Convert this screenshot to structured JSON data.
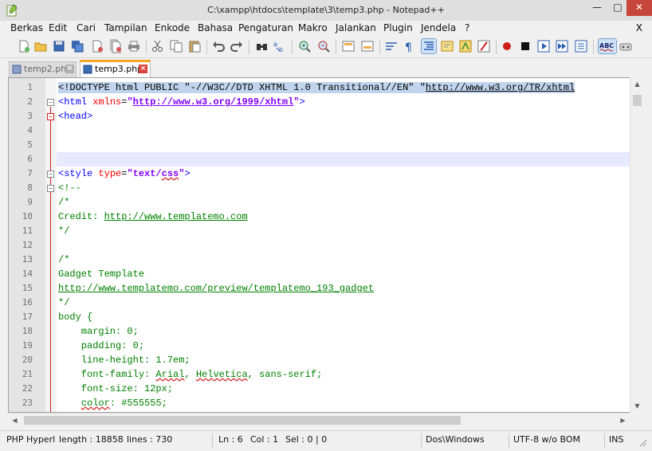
{
  "window": {
    "title": "C:\\xampp\\htdocs\\template\\3\\temp3.php - Notepad++"
  },
  "menu": [
    "Berkas",
    "Edit",
    "Cari",
    "Tampilan",
    "Enkode",
    "Bahasa",
    "Pengaturan",
    "Makro",
    "Jalankan",
    "Plugin",
    "Jendela",
    "?"
  ],
  "menu_close": "X",
  "toolbar_icons": [
    "new-file-icon",
    "open-file-icon",
    "save-icon",
    "save-all-icon",
    "close-icon",
    "close-all-icon",
    "print-icon",
    "cut-icon",
    "copy-icon",
    "paste-icon",
    "undo-icon",
    "redo-icon",
    "find-icon",
    "replace-icon",
    "zoom-in-icon",
    "zoom-out-icon",
    "sync-v-icon",
    "sync-h-icon",
    "word-wrap-icon",
    "show-all-chars-icon",
    "indent-guide-icon",
    "doc-map-icon",
    "function-list-icon",
    "folder-workspace-icon",
    "record-macro-icon",
    "stop-macro-icon",
    "play-macro-icon",
    "run-macro-multiple-icon",
    "save-macro-icon",
    "spellcheck-icon",
    "plugin-icon"
  ],
  "tabs": [
    {
      "label": "temp2.php",
      "active": false
    },
    {
      "label": "temp3.php",
      "active": true
    }
  ],
  "editor": {
    "current_line": 6,
    "lines": [
      {
        "n": "1",
        "fold": "",
        "parts": [
          [
            "sel",
            "<!DOCTYPE html PUBLIC \""
          ],
          [
            "sel",
            "-//W3C//DTD XHTML 1.0 Transitional//EN"
          ],
          [
            "sel",
            "\" \""
          ],
          [
            "selurl",
            "http://www.w3.org/TR/xhtml"
          ]
        ]
      },
      {
        "n": "2",
        "fold": "grey",
        "parts": [
          [
            "tag",
            "<html "
          ],
          [
            "attr",
            "xmlns"
          ],
          [
            "black",
            "="
          ],
          [
            "str",
            "\""
          ],
          [
            "link",
            "http://www.w3.org/1999/xhtml"
          ],
          [
            "str",
            "\""
          ],
          [
            "tag",
            ">"
          ]
        ]
      },
      {
        "n": "3",
        "fold": "red",
        "parts": [
          [
            "tag",
            "<head>"
          ]
        ]
      },
      {
        "n": "4",
        "fold": "",
        "parts": []
      },
      {
        "n": "5",
        "fold": "",
        "parts": []
      },
      {
        "n": "6",
        "fold": "",
        "parts": []
      },
      {
        "n": "7",
        "fold": "grey",
        "parts": [
          [
            "tag",
            "<style "
          ],
          [
            "attr",
            "type"
          ],
          [
            "black",
            "="
          ],
          [
            "str",
            "\"text/"
          ],
          [
            "strwavy",
            "css"
          ],
          [
            "str",
            "\""
          ],
          [
            "tag",
            ">"
          ]
        ]
      },
      {
        "n": "8",
        "fold": "grey",
        "parts": [
          [
            "comment",
            "<!--"
          ]
        ]
      },
      {
        "n": "9",
        "fold": "",
        "parts": [
          [
            "comment",
            "/*"
          ]
        ]
      },
      {
        "n": "10",
        "fold": "",
        "parts": [
          [
            "comment",
            "Credit: "
          ],
          [
            "clink",
            "http://www.templatemo.com"
          ]
        ]
      },
      {
        "n": "11",
        "fold": "",
        "parts": [
          [
            "comment",
            "*/"
          ]
        ]
      },
      {
        "n": "12",
        "fold": "",
        "parts": []
      },
      {
        "n": "13",
        "fold": "",
        "parts": [
          [
            "comment",
            "/*"
          ]
        ]
      },
      {
        "n": "14",
        "fold": "",
        "parts": [
          [
            "comment",
            "Gadget Template"
          ]
        ]
      },
      {
        "n": "15",
        "fold": "",
        "parts": [
          [
            "clink",
            "http://www.templatemo.com/preview/templatemo_193_gadget"
          ]
        ]
      },
      {
        "n": "16",
        "fold": "",
        "parts": [
          [
            "comment",
            "*/"
          ]
        ]
      },
      {
        "n": "17",
        "fold": "",
        "parts": [
          [
            "comment",
            "body {"
          ]
        ]
      },
      {
        "n": "18",
        "fold": "",
        "parts": [
          [
            "comment",
            "    margin: 0;"
          ]
        ]
      },
      {
        "n": "19",
        "fold": "",
        "parts": [
          [
            "comment",
            "    padding: 0;"
          ]
        ]
      },
      {
        "n": "20",
        "fold": "",
        "parts": [
          [
            "comment",
            "    line-height: 1.7em;"
          ]
        ]
      },
      {
        "n": "21",
        "fold": "",
        "parts": [
          [
            "comment",
            "    font-family: "
          ],
          [
            "cwavy",
            "Arial"
          ],
          [
            "comment",
            ", "
          ],
          [
            "cwavy",
            "Helvetica"
          ],
          [
            "comment",
            ", sans-serif;"
          ]
        ]
      },
      {
        "n": "22",
        "fold": "",
        "parts": [
          [
            "comment",
            "    font-size: 12px;"
          ]
        ]
      },
      {
        "n": "23",
        "fold": "",
        "parts": [
          [
            "comment",
            "    "
          ],
          [
            "cwavy",
            "color"
          ],
          [
            "comment",
            ": #555555;"
          ]
        ]
      }
    ]
  },
  "status": {
    "lang": "PHP Hyperl",
    "length": "length : 18858",
    "lines": "lines : 730",
    "ln": "Ln : 6",
    "col": "Col : 1",
    "sel": "Sel : 0 | 0",
    "eol": "Dos\\Windows",
    "encoding": "UTF-8 w/o BOM",
    "mode": "INS"
  }
}
